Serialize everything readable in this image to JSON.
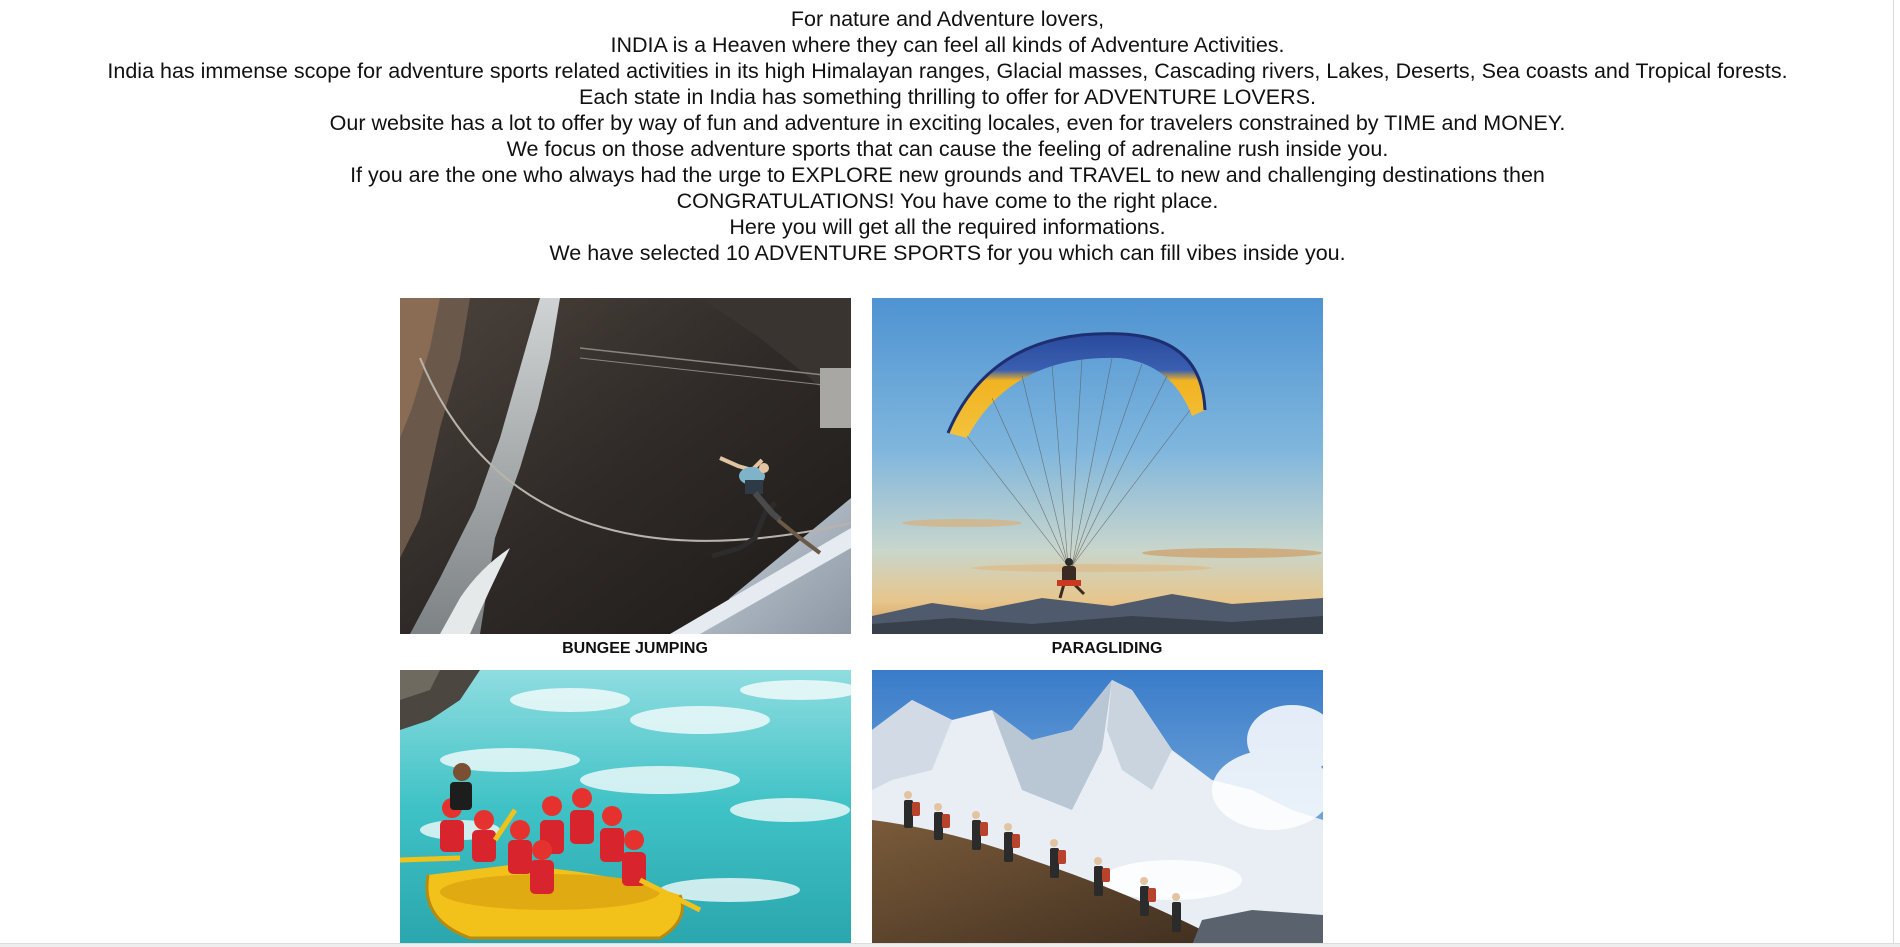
{
  "intro": {
    "lines": [
      "For nature and Adventure lovers,",
      "INDIA is a Heaven where they can feel all kinds of Adventure Activities.",
      "India has immense scope for adventure sports related activities in its high Himalayan ranges, Glacial masses, Cascading rivers, Lakes, Deserts, Sea coasts and Tropical forests.",
      "Each state in India has something thrilling to offer for ADVENTURE LOVERS.",
      "Our website has a lot to offer by way of fun and adventure in exciting locales, even for travelers constrained by TIME and MONEY.",
      "We focus on those adventure sports that can cause the feeling of adrenaline rush inside you.",
      "If you are the one who always had the urge to EXPLORE new grounds and TRAVEL to new and challenging destinations then",
      "CONGRATULATIONS! You have come to the right place.",
      "Here you will get all the required informations.",
      "We have selected 10 ADVENTURE SPORTS for you which can fill vibes inside you."
    ]
  },
  "gallery": {
    "cards": [
      {
        "caption": "BUNGEE JUMPING",
        "image": "bungee-jumping-photo"
      },
      {
        "caption": "PARAGLIDING",
        "image": "paragliding-photo"
      },
      {
        "caption": "",
        "image": "river-rafting-photo"
      },
      {
        "caption": "",
        "image": "trekking-photo"
      }
    ]
  },
  "colors": {
    "background": "#ffffff",
    "text": "#111111",
    "sky": "#5b9fd6",
    "water": "#3fc7c9",
    "raft": "#f2c21a",
    "vest": "#d8242c"
  }
}
